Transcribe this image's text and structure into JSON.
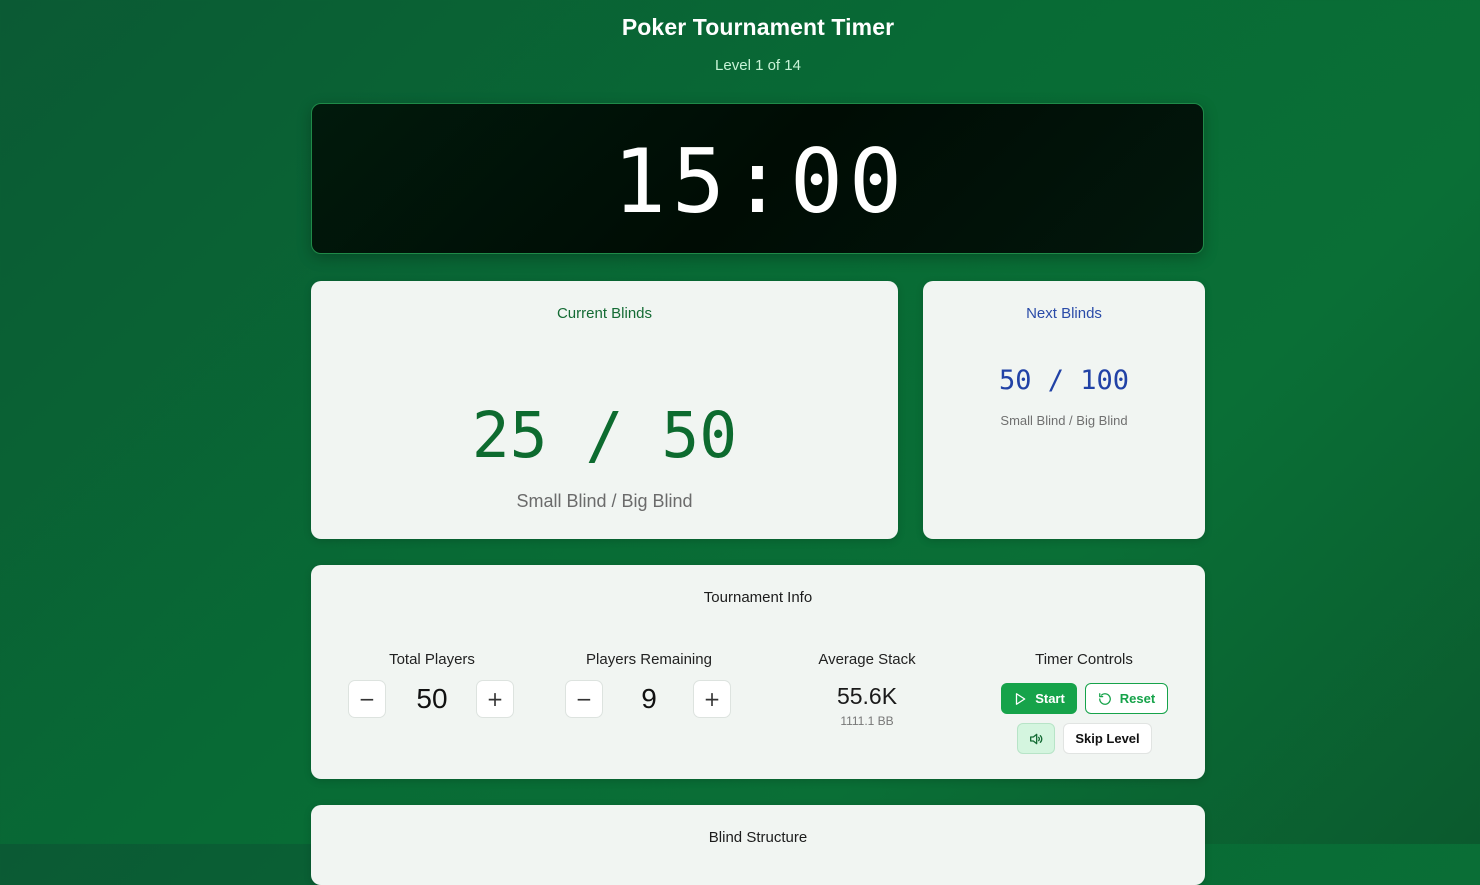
{
  "header": {
    "title": "Poker Tournament Timer",
    "level": "Level 1 of 14"
  },
  "timer": {
    "value": "15:00"
  },
  "current_blinds": {
    "label": "Current Blinds",
    "value": "25 / 50",
    "sub": "Small Blind / Big Blind"
  },
  "next_blinds": {
    "label": "Next Blinds",
    "value": "50 / 100",
    "sub": "Small Blind / Big Blind"
  },
  "tournament_info": {
    "label": "Tournament Info",
    "total_players": {
      "label": "Total Players",
      "value": "50",
      "decrement": "−",
      "increment": "+"
    },
    "players_remaining": {
      "label": "Players Remaining",
      "value": "9",
      "decrement": "−",
      "increment": "+"
    },
    "average_stack": {
      "label": "Average Stack",
      "value": "55.6K",
      "sub": "1111.1 BB"
    },
    "timer_controls": {
      "label": "Timer Controls",
      "start": "Start",
      "reset": "Reset",
      "skip": "Skip Level",
      "icons": {
        "start": "play-icon",
        "reset": "rotate-ccw-icon",
        "sound": "volume-icon"
      }
    }
  },
  "blind_structure": {
    "label": "Blind Structure"
  },
  "colors": {
    "background": "#086b35",
    "accent_green": "#16a34a",
    "current_blinds": "#0d6b2f",
    "next_blinds": "#2142a6",
    "timer_bg": "#000c04"
  }
}
